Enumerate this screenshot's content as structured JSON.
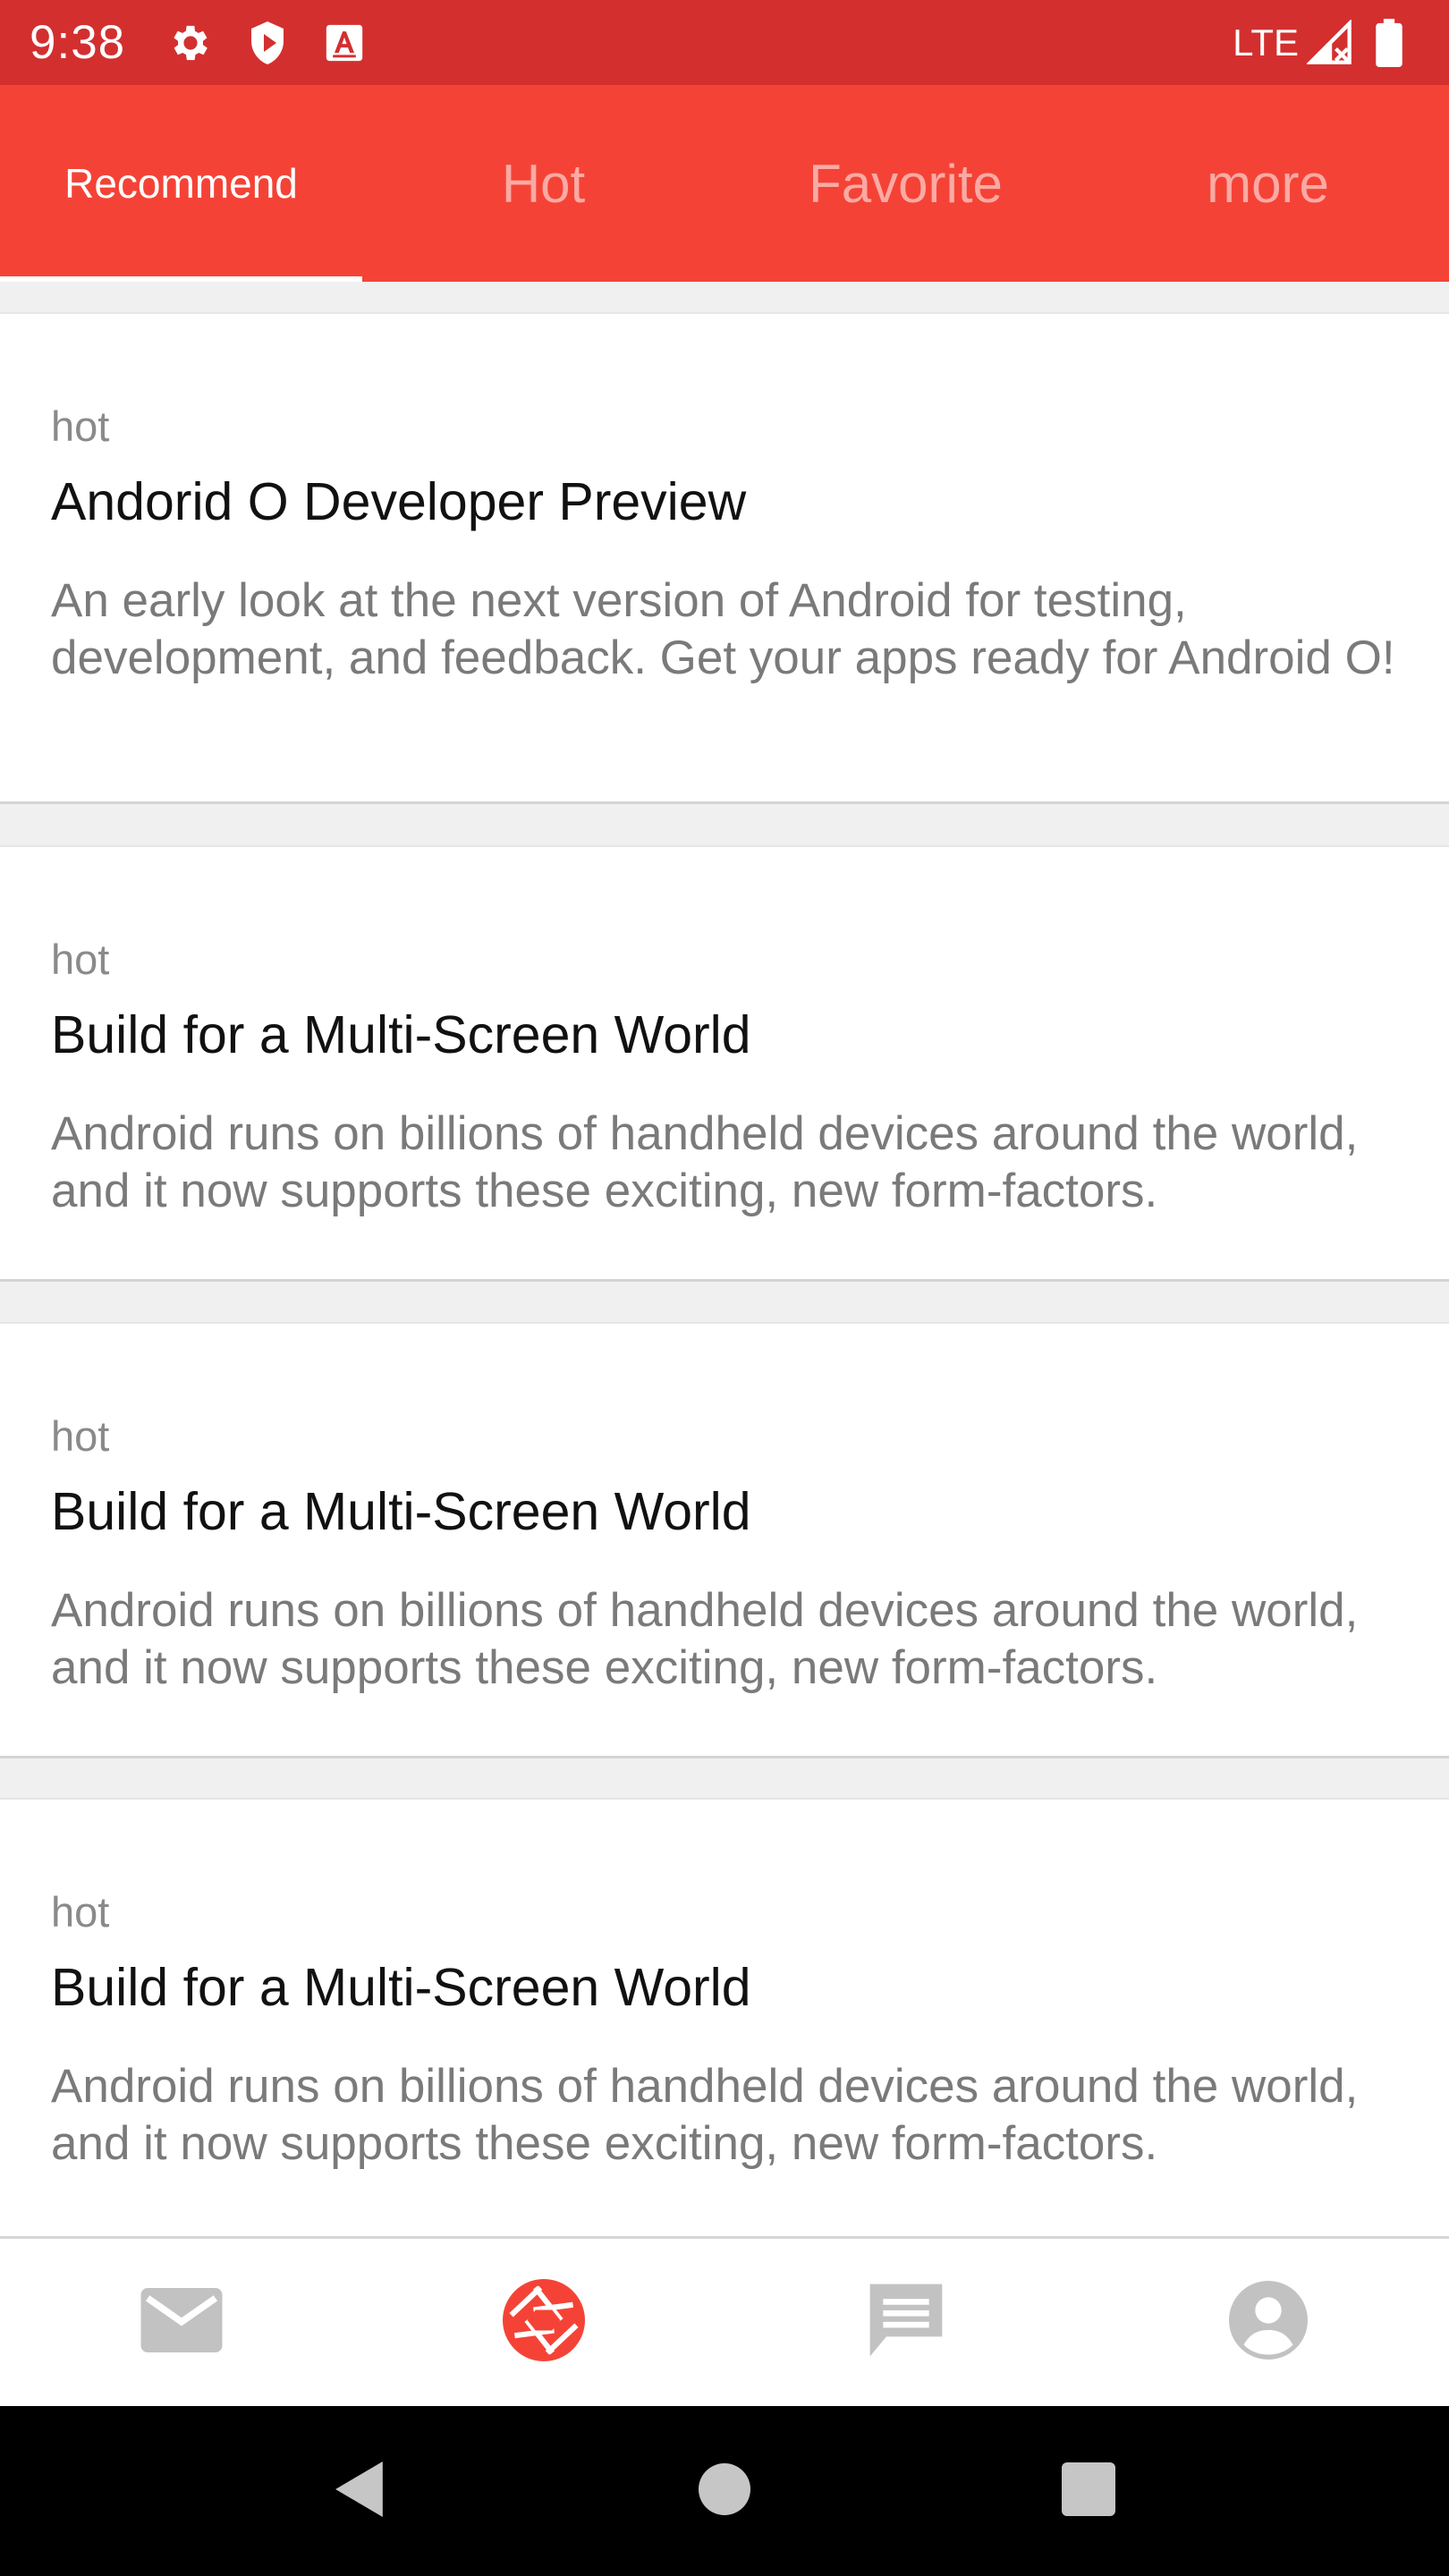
{
  "status_bar": {
    "time": "9:38",
    "network": "LTE",
    "icons": [
      "gear-icon",
      "shield-icon",
      "a-box-icon",
      "signal-icon",
      "battery-icon"
    ]
  },
  "tabs": [
    {
      "label": "Recommend",
      "active": true
    },
    {
      "label": "Hot",
      "active": false
    },
    {
      "label": "Favorite",
      "active": false
    },
    {
      "label": "more",
      "active": false
    }
  ],
  "cards": [
    {
      "tag": "hot",
      "title": "Andorid O Developer Preview",
      "description": "An early look at the next version of Android for testing, development, and feedback. Get your apps ready for Android O!"
    },
    {
      "tag": "hot",
      "title": "Build for a Multi-Screen World",
      "description": "Android runs on billions of handheld devices around the world, and it now supports these exciting, new form-factors."
    },
    {
      "tag": "hot",
      "title": "Build for a Multi-Screen World",
      "description": "Android runs on billions of handheld devices around the world, and it now supports these exciting, new form-factors."
    },
    {
      "tag": "hot",
      "title": "Build for a Multi-Screen World",
      "description": "Android runs on billions of handheld devices around the world, and it now supports these exciting, new form-factors."
    }
  ],
  "bottom_nav": [
    {
      "icon": "mail-icon",
      "active": false
    },
    {
      "icon": "camera-aperture-icon",
      "active": true
    },
    {
      "icon": "message-icon",
      "active": false
    },
    {
      "icon": "account-icon",
      "active": false
    }
  ],
  "system_nav": [
    "back-icon",
    "home-icon",
    "recents-icon"
  ],
  "colors": {
    "status_bar": "#d32f2f",
    "app_bar": "#f44336",
    "accent": "#f44336",
    "inactive_icon": "#c2c2c2"
  }
}
